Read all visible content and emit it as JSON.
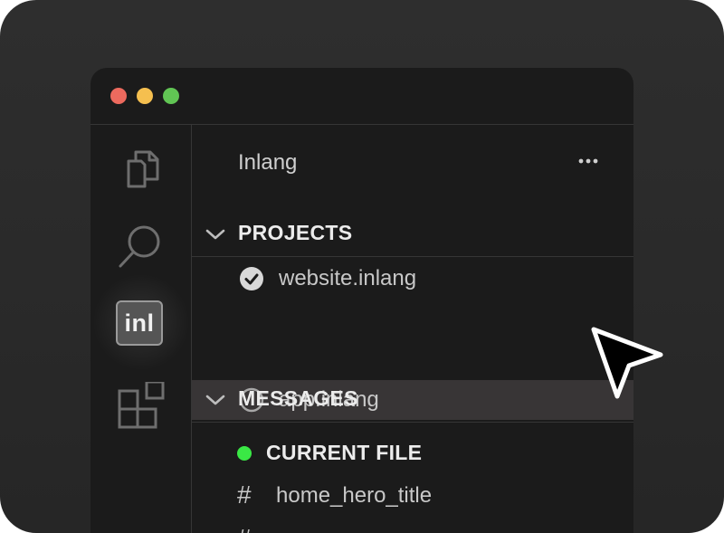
{
  "colors": {
    "traffic_red": "#ed6a5e",
    "traffic_yellow": "#f5bf4f",
    "traffic_green": "#61c554",
    "current_file_dot": "#3ae845",
    "selected_row_bg": "#383536"
  },
  "window": {
    "traffic_lights": [
      "close",
      "minimize",
      "maximize"
    ]
  },
  "activity_bar": {
    "items": [
      {
        "icon": "files-icon",
        "active": false
      },
      {
        "icon": "search-icon",
        "active": false
      },
      {
        "icon": "inlang-icon",
        "label": "inl",
        "active": true
      },
      {
        "icon": "extensions-icon",
        "active": false
      }
    ]
  },
  "sidebar": {
    "title": "Inlang",
    "more_icon": "more-actions-icon",
    "projects": {
      "label": "PROJECTS",
      "items": [
        {
          "label": "website.inlang",
          "selected": true,
          "icon": "check-circle-icon"
        },
        {
          "label": "app.inlang",
          "selected": false,
          "icon": "circle-icon",
          "hovered": true
        }
      ]
    },
    "messages": {
      "label": "MESSAGES",
      "current_file_label": "CURRENT FILE",
      "items": [
        {
          "label": "home_hero_title",
          "icon": "hash-icon"
        },
        {
          "label": "",
          "icon": "hash-icon"
        }
      ]
    }
  },
  "cursor": {
    "icon": "mouse-pointer-icon"
  }
}
